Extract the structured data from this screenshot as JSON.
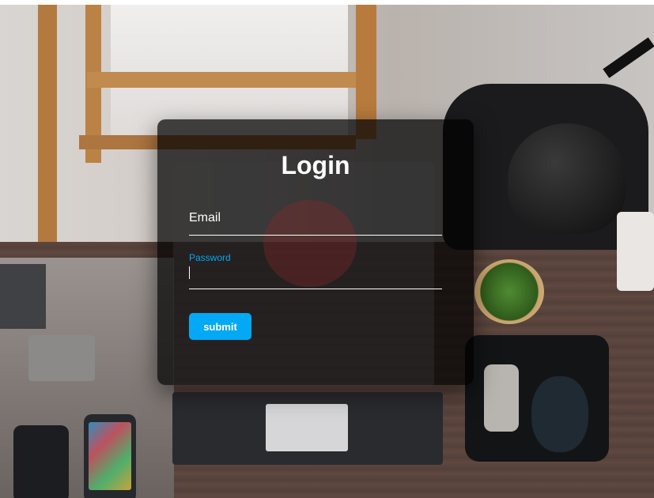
{
  "login": {
    "title": "Login",
    "email_label": "Email",
    "email_value": "",
    "password_label": "Password",
    "password_value": "",
    "submit_label": "submit"
  },
  "colors": {
    "accent": "#03a9f4",
    "card_background": "rgba(0,0,0,0.72)",
    "text": "#ffffff"
  }
}
